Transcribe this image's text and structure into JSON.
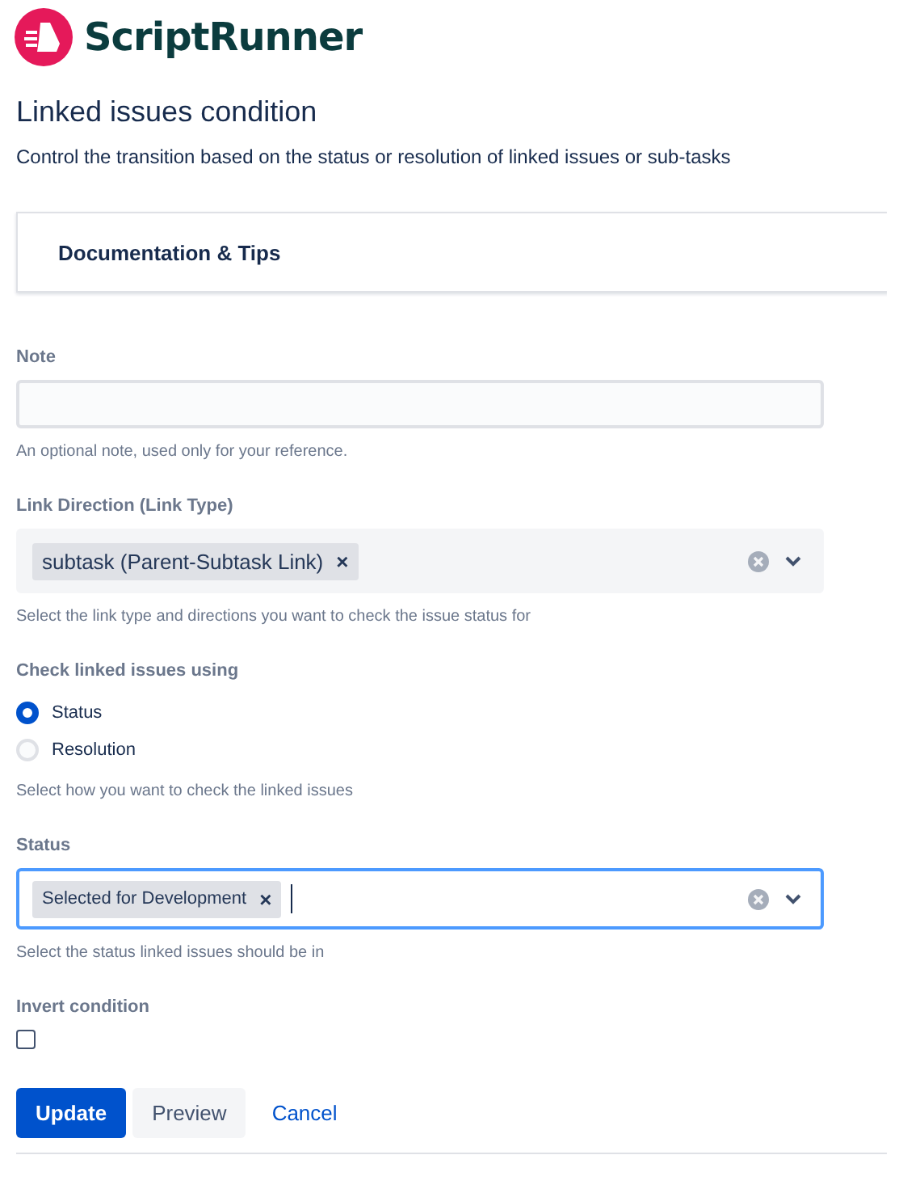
{
  "app": {
    "name": "ScriptRunner"
  },
  "title": "Linked issues condition",
  "description": "Control the transition based on the status or resolution of linked issues or sub-tasks",
  "docs": {
    "label": "Documentation & Tips"
  },
  "note": {
    "label": "Note",
    "help": "An optional note, used only for your reference."
  },
  "link_direction": {
    "label": "Link Direction (Link Type)",
    "focused": false,
    "tags": [
      {
        "text": "subtask (Parent-Subtask Link)",
        "remove": "×"
      }
    ],
    "help": "Select the link type and directions you want to check the issue status for"
  },
  "check_using": {
    "label": "Check linked issues using",
    "options": [
      {
        "label": "Status",
        "selected": true
      },
      {
        "label": "Resolution",
        "selected": false
      }
    ],
    "help": "Select how you want to check the linked issues"
  },
  "status": {
    "label": "Status",
    "focused": true,
    "tags": [
      {
        "text": "Selected for Development",
        "remove": "×"
      }
    ],
    "help": "Select the status linked issues should be in"
  },
  "invert": {
    "label": "Invert condition",
    "checked": false
  },
  "buttons": [
    {
      "label": "Update",
      "kind": "primary"
    },
    {
      "label": "Preview",
      "kind": "secondary"
    },
    {
      "label": "Cancel",
      "kind": "link"
    }
  ]
}
